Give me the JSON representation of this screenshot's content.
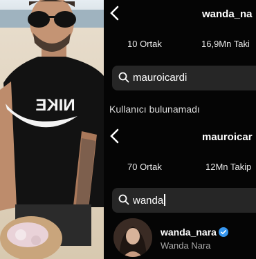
{
  "top_profile": {
    "username": "wanda_na",
    "mutuals": "10 Ortak",
    "followers": "16,9Mn Taki",
    "search_value": "mauroicardi",
    "empty_message": "Kullanıcı bulunamadı"
  },
  "bottom_profile": {
    "username": "mauroicar",
    "mutuals": "70 Ortak",
    "followers": "12Mn Takip",
    "search_value": "wanda"
  },
  "result": {
    "username": "wanda_nara",
    "full_name": "Wanda Nara",
    "verified": true
  },
  "colors": {
    "verified_badge": "#3797f0",
    "search_bg": "#262626",
    "secondary_text": "#a8a8a8"
  },
  "icons": [
    "back-arrow-icon",
    "search-icon",
    "verified-badge-icon"
  ],
  "photo": {
    "shirt_logo": "NIKE"
  }
}
